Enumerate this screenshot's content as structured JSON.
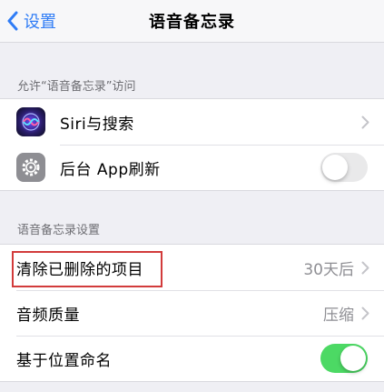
{
  "navbar": {
    "back_label": "设置",
    "title": "语音备忘录"
  },
  "access_section": {
    "header": "允许“语音备忘录”访问",
    "items": [
      {
        "label": "Siri与搜索",
        "icon": "siri-icon",
        "control": "chevron"
      },
      {
        "label": "后台 App刷新",
        "icon": "gear-icon",
        "control": "toggle",
        "toggle_on": false
      }
    ]
  },
  "settings_section": {
    "header": "语音备忘录设置",
    "items": [
      {
        "label": "清除已删除的项目",
        "value": "30天后",
        "control": "chevron",
        "highlighted": true
      },
      {
        "label": "音频质量",
        "value": "压缩",
        "control": "chevron"
      },
      {
        "label": "基于位置命名",
        "control": "toggle",
        "toggle_on": true
      }
    ]
  },
  "colors": {
    "accent": "#2f7cf6",
    "toggle_on": "#4cd964",
    "highlight": "#d23b3b"
  }
}
